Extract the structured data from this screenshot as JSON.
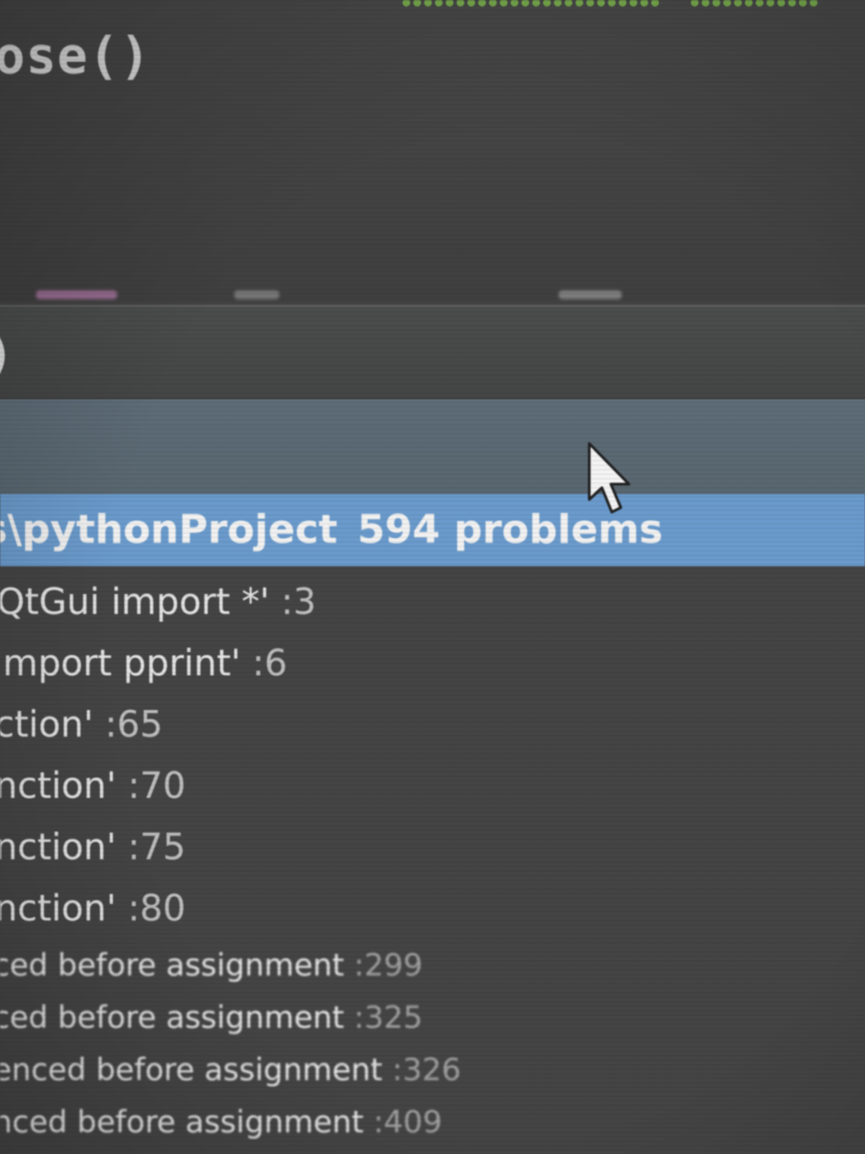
{
  "editor": {
    "code_line": "ose()"
  },
  "problems_panel": {
    "header_fragment": ")",
    "project": {
      "path": "s\\pythonProject",
      "problem_count": "594 problems"
    },
    "problems": [
      {
        "text": "QtGui import *' ",
        "line": ":3"
      },
      {
        "text": "import pprint' ",
        "line": ":6"
      },
      {
        "text": "ction' ",
        "line": ":65"
      },
      {
        "text": "nction' ",
        "line": ":70"
      },
      {
        "text": "nction' ",
        "line": ":75"
      },
      {
        "text": "nction' ",
        "line": ":80"
      },
      {
        "text": "ced before assignment ",
        "line": ":299"
      },
      {
        "text": "ced before assignment ",
        "line": ":325"
      },
      {
        "text": "enced before assignment ",
        "line": ":326"
      },
      {
        "text": "nced before assignment ",
        "line": ":409"
      }
    ]
  },
  "colors": {
    "selection": "#6a9acb",
    "toolbar": "#5d6c77",
    "panel_bg": "#444444",
    "squiggle": "#7db44e"
  },
  "icons": {
    "cursor": "mouse-pointer-icon"
  }
}
